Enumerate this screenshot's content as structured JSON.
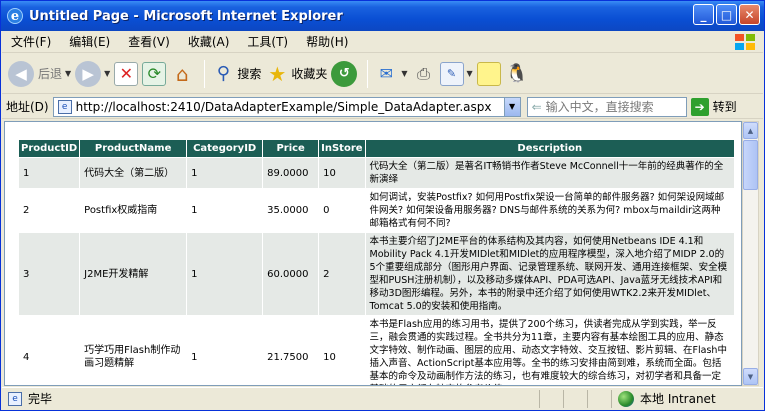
{
  "window": {
    "title": "Untitled Page - Microsoft Internet Explorer"
  },
  "menu": [
    "文件(F)",
    "编辑(E)",
    "查看(V)",
    "收藏(A)",
    "工具(T)",
    "帮助(H)"
  ],
  "toolbar": {
    "back": "后退",
    "search": "搜索",
    "favorites": "收藏夹"
  },
  "address": {
    "label": "地址(D)",
    "url": "http://localhost:2410/DataAdapterExample/Simple_DataAdapter.aspx",
    "search_placeholder": "输入中文，直接搜索",
    "go": "转到"
  },
  "table": {
    "headers": [
      "ProductID",
      "ProductName",
      "CategoryID",
      "Price",
      "InStore",
      "Description"
    ],
    "rows": [
      [
        "1",
        "代码大全（第二版）",
        "1",
        "89.0000",
        "10",
        "代码大全（第二版）是著名IT畅销书作者Steve McConnell十一年前的经典著作的全新演绎"
      ],
      [
        "2",
        "Postfix权威指南",
        "1",
        "35.0000",
        "0",
        "如何调试，安装Postfix? 如何用Postfix架设一台简单的邮件服务器? 如何架设网域邮件网关? 如何架设备用服务器? DNS与邮件系统的关系为何? mbox与maildir这两种邮箱格式有何不同?"
      ],
      [
        "3",
        "J2ME开发精解",
        "1",
        "60.0000",
        "2",
        "本书主要介绍了J2ME平台的体系结构及其内容，如何使用Netbeans IDE 4.1和Mobility Pack 4.1开发MIDlet和MIDlet的应用程序模型，深入地介绍了MIDP 2.0的5个重要组成部分（图形用户界面、记录管理系统、联网开发、通用连接框架、安全模型和PUSH注册机制），以及移动多媒体API、PDA可选API、Java蓝牙无线技术API和移动3D图形编程。另外，本书的附录中还介绍了如何使用WTK2.2来开发MIDlet、Tomcat 5.0的安装和使用指南。"
      ],
      [
        "4",
        "巧学巧用Flash制作动画习题精解",
        "1",
        "21.7500",
        "10",
        "本书是Flash应用的练习用书，提供了200个练习，供读者完成从学到实践，举一反三，融会贯通的实践过程。全书共分为11章，主要内容有基本绘图工具的应用、静态文字特效、制作动画、图层的应用、动态文字特效、交互按钮、影片剪辑、在Flash中插入声音、ActionScript基本应用等。全书的练习安排由简到难，系统而全面。包括基本的命令及动画制作方法的练习，也有难度较大的综合练习，对初学者和具备一定基础的用户都有较高的参考价值。"
      ]
    ]
  },
  "status": {
    "left": "完毕",
    "zone": "本地 Intranet"
  }
}
